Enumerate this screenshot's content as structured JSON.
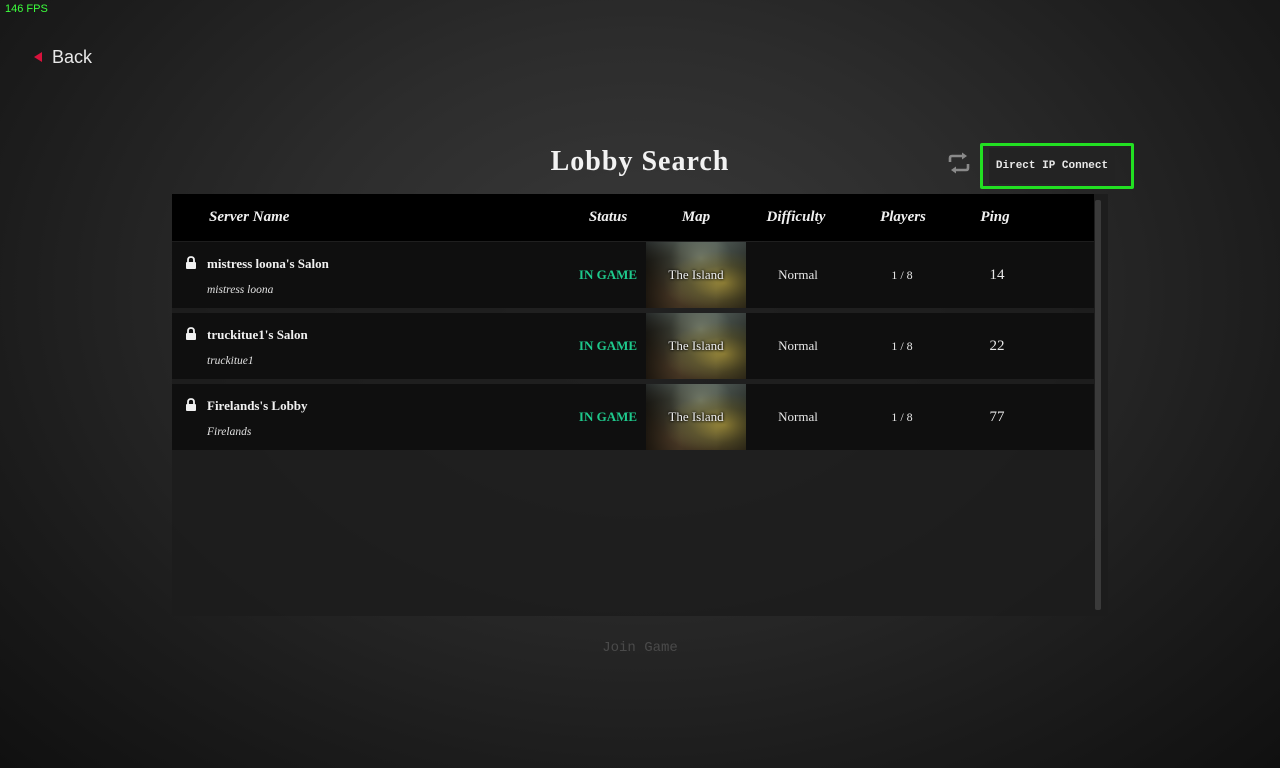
{
  "overlay": {
    "fps": "146 FPS"
  },
  "nav": {
    "back_label": "Back"
  },
  "page": {
    "title": "Lobby Search"
  },
  "toolbar": {
    "refresh_icon": "refresh-icon",
    "direct_ip_label": "Direct IP Connect",
    "direct_ip_highlight_color": "#22e022"
  },
  "table": {
    "headers": {
      "server_name": "Server Name",
      "status": "Status",
      "map": "Map",
      "difficulty": "Difficulty",
      "players": "Players",
      "ping": "Ping"
    },
    "rows": [
      {
        "locked": true,
        "name": "mistress loona's Salon",
        "host": "mistress loona",
        "status": "IN GAME",
        "map": "The Island",
        "difficulty": "Normal",
        "players": "1 / 8",
        "ping": "14"
      },
      {
        "locked": true,
        "name": "truckitue1's Salon",
        "host": "truckitue1",
        "status": "IN GAME",
        "map": "The Island",
        "difficulty": "Normal",
        "players": "1 / 8",
        "ping": "22"
      },
      {
        "locked": true,
        "name": "Firelands's Lobby",
        "host": "Firelands",
        "status": "IN GAME",
        "map": "The Island",
        "difficulty": "Normal",
        "players": "1 / 8",
        "ping": "77"
      }
    ]
  },
  "footer": {
    "join_label": "Join Game"
  },
  "colors": {
    "status_in_game": "#1ec98c",
    "back_arrow": "#d8123c",
    "fps_text": "#3cff3c"
  }
}
